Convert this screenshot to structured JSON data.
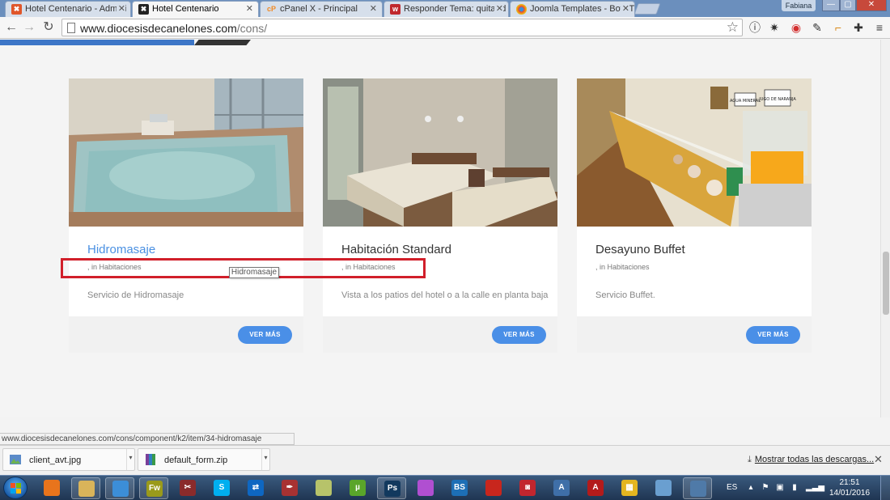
{
  "browser": {
    "tabs": [
      {
        "title": "Hotel Centenario - Admini",
        "favicon": "joomla-icon",
        "color": "#e0562a"
      },
      {
        "title": "Hotel Centenario",
        "favicon": "joomla-icon",
        "color": "#222222"
      },
      {
        "title": "cPanel X - Principal",
        "favicon": "cpanel-icon",
        "color": "#f08a24"
      },
      {
        "title": "Responder Tema: quitar d",
        "favicon": "forum-icon",
        "color": "#c0282d"
      },
      {
        "title": "Joomla Templates - Bow T",
        "favicon": "chrome-icon",
        "color": "#3c8ed8"
      }
    ],
    "active_tab_index": 1,
    "profile_name": "Fabiana",
    "window_buttons": [
      "—",
      "▢",
      "✕"
    ],
    "address": {
      "host": "www.diocesisdecanelones.com",
      "path": "/cons/"
    },
    "status_url": "www.diocesisdecanelones.com/cons/component/k2/item/34-hidromasaje"
  },
  "cards": [
    {
      "title": "Hidromasaje",
      "meta": ", in Habitaciones",
      "description": "Servicio de Hidromasaje",
      "button": "VER MÁS",
      "hovered": true
    },
    {
      "title": "Habitación Standard",
      "meta": ", in Habitaciones",
      "description": "Vista a los patios del hotel o a la calle en planta baja",
      "button": "VER MÁS",
      "hovered": false
    },
    {
      "title": "Desayuno Buffet",
      "meta": ", in Habitaciones",
      "description": "Servicio Buffet.",
      "button": "VER MÁS",
      "hovered": false
    }
  ],
  "tooltip": "Hidromasaje",
  "photo_labels": {
    "sign1": "AGUA MINERAL",
    "sign2": "JUGO DE NARANJA"
  },
  "downloads": {
    "items": [
      {
        "name": "client_avt.jpg",
        "icon": "image-file-icon"
      },
      {
        "name": "default_form.zip",
        "icon": "zip-file-icon"
      }
    ],
    "show_all": "Mostrar todas las descargas...",
    "close": "✕"
  },
  "taskbar": {
    "language": "ES",
    "time": "21:51",
    "date": "14/01/2016",
    "apps": [
      {
        "name": "media-player-icon",
        "label": "",
        "color": "#e8741c"
      },
      {
        "name": "file-explorer-icon",
        "label": "",
        "color": "#d9b45a"
      },
      {
        "name": "chrome-icon",
        "label": "",
        "color": "#3c8ed8"
      },
      {
        "name": "fireworks-icon",
        "label": "Fw",
        "color": "#9a9a1a"
      },
      {
        "name": "snipping-tool-icon",
        "label": "✂",
        "color": "#8a2b2b"
      },
      {
        "name": "skype-icon",
        "label": "S",
        "color": "#00aff0"
      },
      {
        "name": "teamviewer-icon",
        "label": "⇄",
        "color": "#0e67c2"
      },
      {
        "name": "feather-app-icon",
        "label": "✒",
        "color": "#a83232"
      },
      {
        "name": "folder-app-icon",
        "label": "",
        "color": "#b7c36a"
      },
      {
        "name": "utorrent-icon",
        "label": "µ",
        "color": "#5aa52a"
      },
      {
        "name": "photoshop-icon",
        "label": "Ps",
        "color": "#12395e"
      },
      {
        "name": "picasa-icon",
        "label": "",
        "color": "#b04fd1"
      },
      {
        "name": "bs-player-icon",
        "label": "BS",
        "color": "#1d6fb6"
      },
      {
        "name": "filezilla-icon",
        "label": "",
        "color": "#c8261d"
      },
      {
        "name": "game-app-icon",
        "label": "◙",
        "color": "#c2262e"
      },
      {
        "name": "network-app-icon",
        "label": "A",
        "color": "#3f6fa8"
      },
      {
        "name": "acrobat-icon",
        "label": "A",
        "color": "#b31b1b"
      },
      {
        "name": "apps-grid-icon",
        "label": "▦",
        "color": "#e3b520"
      },
      {
        "name": "notepad-icon",
        "label": "",
        "color": "#6a9fd0"
      },
      {
        "name": "screenshot-icon",
        "label": "",
        "color": "#4f7aa8"
      }
    ]
  }
}
